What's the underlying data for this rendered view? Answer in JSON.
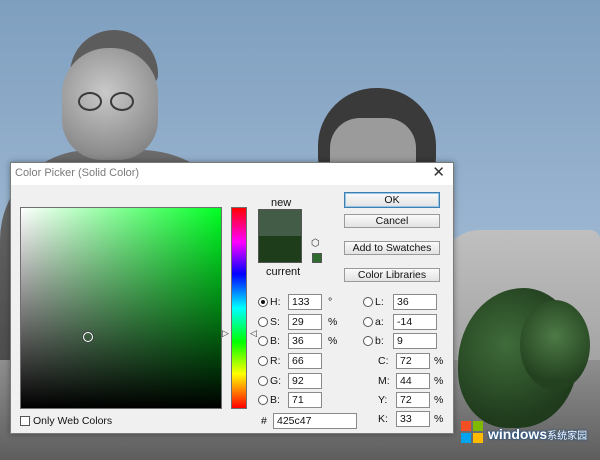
{
  "dialog": {
    "title": "Color Picker (Solid Color)",
    "close_glyph": "✕"
  },
  "preview": {
    "new_label": "new",
    "current_label": "current",
    "new_color": "#425c47",
    "current_color": "#1e3e1b"
  },
  "buttons": {
    "ok": "OK",
    "cancel": "Cancel",
    "add_to_swatches": "Add to Swatches",
    "color_libraries": "Color Libraries"
  },
  "hsb": {
    "h": {
      "label": "H:",
      "value": "133",
      "unit": "°"
    },
    "s": {
      "label": "S:",
      "value": "29",
      "unit": "%"
    },
    "b": {
      "label": "B:",
      "value": "36",
      "unit": "%"
    }
  },
  "rgb": {
    "r": {
      "label": "R:",
      "value": "66"
    },
    "g": {
      "label": "G:",
      "value": "92"
    },
    "b": {
      "label": "B:",
      "value": "71"
    }
  },
  "lab": {
    "l": {
      "label": "L:",
      "value": "36"
    },
    "a": {
      "label": "a:",
      "value": "-14"
    },
    "b": {
      "label": "b:",
      "value": "9"
    }
  },
  "cmyk": {
    "c": {
      "label": "C:",
      "value": "72",
      "unit": "%"
    },
    "m": {
      "label": "M:",
      "value": "44",
      "unit": "%"
    },
    "y": {
      "label": "Y:",
      "value": "72",
      "unit": "%"
    },
    "k": {
      "label": "K:",
      "value": "33",
      "unit": "%"
    }
  },
  "hex": {
    "label": "#",
    "value": "425c47"
  },
  "web_colors": {
    "label": "Only Web Colors",
    "checked": false
  },
  "watermark": {
    "brand": "windows",
    "suffix": "系统家园"
  }
}
